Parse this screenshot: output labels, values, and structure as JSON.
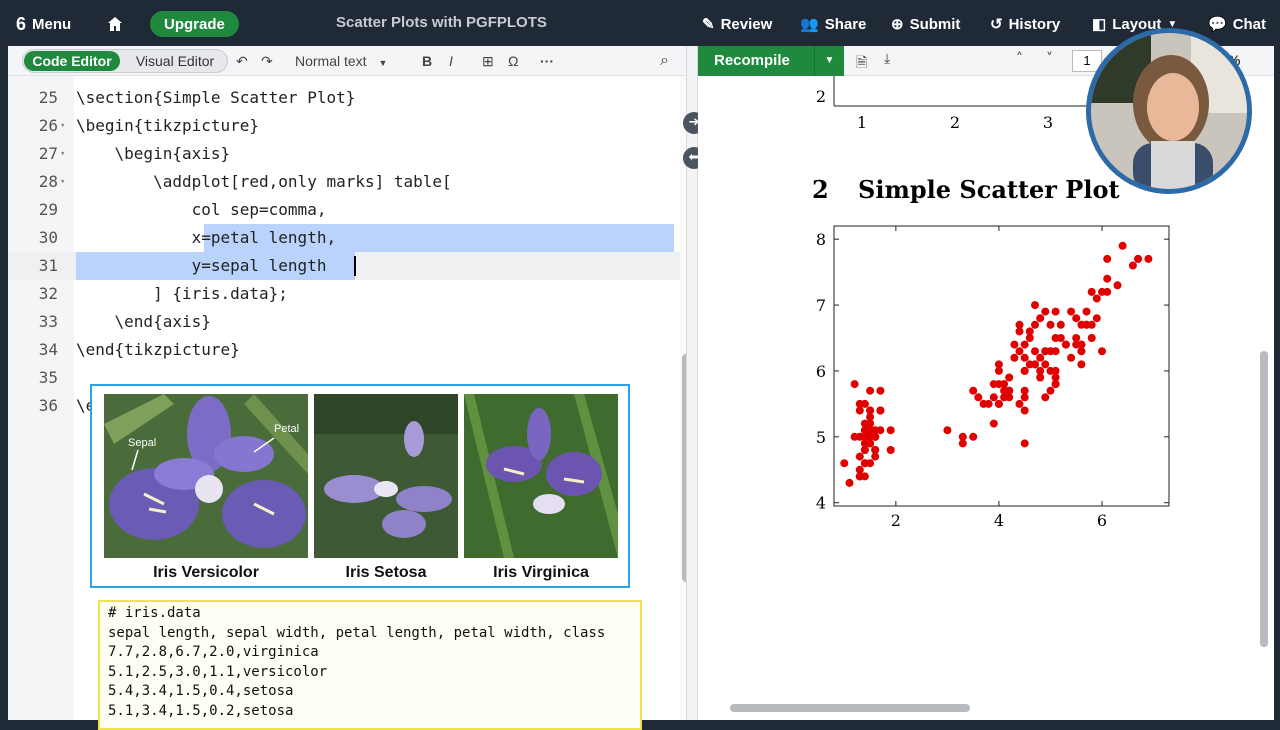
{
  "topbar": {
    "menu": "Menu",
    "upgrade": "Upgrade",
    "doc_title": "Scatter Plots with PGFPLOTS",
    "review": "Review",
    "share": "Share",
    "submit": "Submit",
    "history": "History",
    "layout": "Layout",
    "chat": "Chat"
  },
  "editor_toolbar": {
    "code_editor": "Code Editor",
    "visual_editor": "Visual Editor",
    "text_style": "Normal text",
    "bold": "B",
    "italic": "I",
    "omega": "Ω",
    "more": "···"
  },
  "code_lines": [
    {
      "n": "25",
      "text": "\\section{Simple Scatter Plot}"
    },
    {
      "n": "26",
      "text": "\\begin{tikzpicture}"
    },
    {
      "n": "27",
      "text": "    \\begin{axis}"
    },
    {
      "n": "28",
      "text": "        \\addplot[red,only marks] table["
    },
    {
      "n": "29",
      "text": "            col sep=comma,"
    },
    {
      "n": "30",
      "text": "            x=petal length,"
    },
    {
      "n": "31",
      "text": "            y=sepal length"
    },
    {
      "n": "32",
      "text": "        ] {iris.data};"
    },
    {
      "n": "33",
      "text": "    \\end{axis}"
    },
    {
      "n": "34",
      "text": "\\end{tikzpicture}"
    },
    {
      "n": "35",
      "text": ""
    },
    {
      "n": "36",
      "text": "\\e"
    }
  ],
  "iris_image": {
    "labels": [
      "Iris Versicolor",
      "Iris Setosa",
      "Iris Virginica"
    ],
    "annot_sepal": "Sepal",
    "annot_petal": "Petal"
  },
  "data_file": {
    "lines": [
      "# iris.data",
      "sepal length, sepal width, petal length, petal width, class",
      "7.7,2.8,6.7,2.0,virginica",
      "5.1,2.5,3.0,1.1,versicolor",
      "5.4,3.4,1.5,0.4,setosa",
      "5.1,3.4,1.5,0.2,setosa"
    ]
  },
  "pdf_toolbar": {
    "recompile": "Recompile",
    "page": "1",
    "zoom": "%"
  },
  "pdf": {
    "section_num": "2",
    "section_title": "Simple Scatter Plot",
    "prev_plot_xticks": [
      "1",
      "2",
      "3"
    ],
    "prev_plot_ytick": "2"
  },
  "chart_data": {
    "type": "scatter",
    "title": "",
    "xlabel": "",
    "ylabel": "",
    "xlim": [
      0.8,
      7.3
    ],
    "ylim": [
      3.95,
      8.2
    ],
    "xticks": [
      2,
      4,
      6
    ],
    "yticks": [
      4,
      5,
      6,
      7,
      8
    ],
    "grid": false,
    "color": "#e00000",
    "series": [
      {
        "points": [
          [
            1.4,
            5.1
          ],
          [
            1.4,
            4.9
          ],
          [
            1.3,
            4.7
          ],
          [
            1.5,
            4.6
          ],
          [
            1.4,
            5.0
          ],
          [
            1.7,
            5.4
          ],
          [
            1.4,
            4.6
          ],
          [
            1.5,
            5.0
          ],
          [
            1.4,
            4.4
          ],
          [
            1.5,
            4.9
          ],
          [
            1.5,
            5.4
          ],
          [
            1.6,
            4.8
          ],
          [
            1.4,
            4.8
          ],
          [
            1.1,
            4.3
          ],
          [
            1.2,
            5.8
          ],
          [
            1.5,
            5.7
          ],
          [
            1.3,
            5.4
          ],
          [
            1.4,
            5.1
          ],
          [
            1.7,
            5.7
          ],
          [
            1.5,
            5.1
          ],
          [
            1.7,
            5.4
          ],
          [
            1.5,
            5.1
          ],
          [
            1.0,
            4.6
          ],
          [
            1.7,
            5.1
          ],
          [
            1.9,
            4.8
          ],
          [
            1.6,
            5.0
          ],
          [
            1.6,
            5.0
          ],
          [
            1.5,
            5.2
          ],
          [
            1.4,
            5.2
          ],
          [
            1.6,
            4.7
          ],
          [
            1.6,
            4.8
          ],
          [
            1.5,
            5.4
          ],
          [
            1.5,
            5.2
          ],
          [
            1.4,
            5.5
          ],
          [
            1.5,
            4.9
          ],
          [
            1.2,
            5.0
          ],
          [
            1.3,
            5.5
          ],
          [
            1.4,
            4.9
          ],
          [
            1.3,
            4.4
          ],
          [
            1.5,
            5.1
          ],
          [
            1.3,
            5.0
          ],
          [
            1.3,
            4.5
          ],
          [
            1.3,
            4.4
          ],
          [
            1.6,
            5.0
          ],
          [
            1.9,
            5.1
          ],
          [
            1.4,
            4.8
          ],
          [
            1.6,
            5.1
          ],
          [
            1.4,
            4.6
          ],
          [
            1.5,
            5.3
          ],
          [
            1.4,
            5.0
          ],
          [
            4.7,
            7.0
          ],
          [
            4.5,
            6.4
          ],
          [
            4.9,
            6.9
          ],
          [
            4.0,
            5.5
          ],
          [
            4.6,
            6.5
          ],
          [
            4.5,
            5.7
          ],
          [
            4.7,
            6.3
          ],
          [
            3.3,
            4.9
          ],
          [
            4.6,
            6.6
          ],
          [
            3.9,
            5.2
          ],
          [
            3.5,
            5.0
          ],
          [
            4.2,
            5.9
          ],
          [
            4.0,
            6.0
          ],
          [
            4.7,
            6.1
          ],
          [
            3.6,
            5.6
          ],
          [
            4.4,
            6.7
          ],
          [
            4.5,
            5.6
          ],
          [
            4.1,
            5.8
          ],
          [
            4.5,
            6.2
          ],
          [
            3.9,
            5.6
          ],
          [
            4.8,
            5.9
          ],
          [
            4.0,
            6.1
          ],
          [
            4.9,
            6.3
          ],
          [
            4.7,
            6.1
          ],
          [
            4.3,
            6.4
          ],
          [
            4.4,
            6.6
          ],
          [
            4.8,
            6.8
          ],
          [
            5.0,
            6.7
          ],
          [
            4.5,
            6.0
          ],
          [
            3.5,
            5.7
          ],
          [
            3.8,
            5.5
          ],
          [
            3.7,
            5.5
          ],
          [
            3.9,
            5.8
          ],
          [
            5.1,
            6.0
          ],
          [
            4.5,
            5.4
          ],
          [
            4.5,
            6.0
          ],
          [
            4.7,
            6.7
          ],
          [
            4.4,
            6.3
          ],
          [
            4.1,
            5.6
          ],
          [
            4.0,
            5.5
          ],
          [
            4.4,
            5.5
          ],
          [
            4.6,
            6.1
          ],
          [
            4.0,
            5.8
          ],
          [
            3.3,
            5.0
          ],
          [
            4.2,
            5.6
          ],
          [
            4.2,
            5.7
          ],
          [
            4.2,
            5.7
          ],
          [
            4.3,
            6.2
          ],
          [
            3.0,
            5.1
          ],
          [
            4.1,
            5.7
          ],
          [
            6.0,
            6.3
          ],
          [
            5.1,
            5.8
          ],
          [
            5.9,
            7.1
          ],
          [
            5.6,
            6.3
          ],
          [
            5.8,
            6.5
          ],
          [
            6.6,
            7.6
          ],
          [
            4.5,
            4.9
          ],
          [
            6.3,
            7.3
          ],
          [
            5.8,
            6.7
          ],
          [
            6.1,
            7.2
          ],
          [
            5.1,
            6.5
          ],
          [
            5.3,
            6.4
          ],
          [
            5.5,
            6.8
          ],
          [
            5.0,
            5.7
          ],
          [
            5.1,
            5.8
          ],
          [
            5.3,
            6.4
          ],
          [
            5.5,
            6.5
          ],
          [
            6.7,
            7.7
          ],
          [
            6.9,
            7.7
          ],
          [
            5.0,
            6.0
          ],
          [
            5.7,
            6.9
          ],
          [
            4.9,
            5.6
          ],
          [
            6.7,
            7.7
          ],
          [
            4.9,
            6.3
          ],
          [
            5.7,
            6.7
          ],
          [
            6.0,
            7.2
          ],
          [
            4.8,
            6.2
          ],
          [
            4.9,
            6.1
          ],
          [
            5.6,
            6.4
          ],
          [
            5.8,
            7.2
          ],
          [
            6.1,
            7.4
          ],
          [
            6.4,
            7.9
          ],
          [
            5.6,
            6.4
          ],
          [
            5.1,
            6.3
          ],
          [
            5.6,
            6.1
          ],
          [
            6.1,
            7.7
          ],
          [
            5.6,
            6.3
          ],
          [
            5.5,
            6.4
          ],
          [
            4.8,
            6.0
          ],
          [
            5.4,
            6.9
          ],
          [
            5.6,
            6.7
          ],
          [
            5.1,
            6.9
          ],
          [
            5.9,
            6.8
          ],
          [
            5.7,
            6.7
          ],
          [
            5.2,
            6.7
          ],
          [
            5.0,
            6.3
          ],
          [
            5.2,
            6.5
          ],
          [
            5.4,
            6.2
          ],
          [
            5.1,
            5.9
          ]
        ]
      }
    ]
  }
}
